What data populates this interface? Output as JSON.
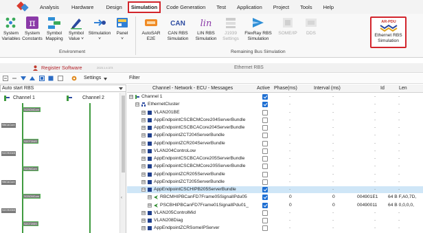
{
  "menu": {
    "items": [
      "Analysis",
      "Hardware",
      "Design",
      "Simulation",
      "Code Generation",
      "Test",
      "Application",
      "Project",
      "Tools",
      "Help"
    ],
    "active": "Simulation"
  },
  "ribbon": {
    "buttons": [
      {
        "l1": "System",
        "l2": "Variables"
      },
      {
        "l1": "System",
        "l2": "Constants"
      },
      {
        "l1": "Symbol",
        "l2": "Mapping"
      },
      {
        "l1": "Symbol",
        "l2": "Value ˅"
      },
      {
        "l1": "Stimulation",
        "l2": "˅"
      },
      {
        "l1": "Panel",
        "l2": "˅"
      },
      {
        "l1": "AutoSAR",
        "l2": "E2E"
      },
      {
        "l1": "CAN RBS",
        "l2": "Simulation"
      },
      {
        "l1": "LIN RBS",
        "l2": "Simulation"
      },
      {
        "l1": "J1939",
        "l2": "Settings"
      },
      {
        "l1": "FlexRay RBS",
        "l2": "Simulation"
      },
      {
        "l1": "SOME/IP",
        "l2": ""
      },
      {
        "l1": "DDS",
        "l2": ""
      },
      {
        "l1": "Ethernet RBS",
        "l2": "Simulation"
      }
    ],
    "icon_texts": {
      "can": "CAN",
      "lin": "lin",
      "ar_pdu": "AR-PDU"
    },
    "groups": {
      "environment": "Environment",
      "remaining": "Remaining Bus Simulation"
    }
  },
  "title": {
    "register": "Register Software",
    "register_sub": "2023.1.4.373",
    "ethernet_rbs": "Ethernet RBS"
  },
  "toolbar": {
    "settings": "Settings",
    "filter": "Filter"
  },
  "left": {
    "autostart": "Auto start RBS",
    "channel1": "Channel 1",
    "channel2": "Channel 2",
    "ecus": [
      "SCBCMCore",
      "SBCACore",
      "SZCT204S",
      "SZCR204S",
      "SZONCore",
      "SBCACore",
      "SCBCMCore",
      "SZCR205S",
      "SZCT205S"
    ]
  },
  "table": {
    "headers": {
      "name": "Channel - Network - ECU - Messages",
      "active": "Active",
      "phase": "Phase(ms)",
      "interval": "Interval (ms)",
      "id": "Id",
      "len": "Len"
    },
    "rows": [
      {
        "name": "Channel 1",
        "indent": 0,
        "exp": "⊟",
        "icon": "channel",
        "active": true,
        "phase": "-",
        "interval": "-",
        "id": "-",
        "len": "-",
        "selected": false
      },
      {
        "name": "EthernetCluster",
        "indent": 1,
        "exp": "⊟",
        "icon": "cluster",
        "active": true,
        "phase": "-",
        "interval": "-",
        "id": "-",
        "len": "-",
        "selected": false
      },
      {
        "name": "VLAN201BE",
        "indent": 2,
        "exp": "⊞",
        "icon": "node",
        "active": false,
        "phase": "-",
        "interval": "-",
        "id": "-",
        "len": "-",
        "selected": false
      },
      {
        "name": "AppEndpointCSCBCMCore204ServerBundle",
        "indent": 2,
        "exp": "⊞",
        "icon": "node",
        "active": false,
        "phase": "-",
        "interval": "-",
        "id": "-",
        "len": "-",
        "selected": false
      },
      {
        "name": "AppEndpointCSCBCACore204ServerBundle",
        "indent": 2,
        "exp": "⊞",
        "icon": "node",
        "active": false,
        "phase": "-",
        "interval": "-",
        "id": "-",
        "len": "-",
        "selected": false
      },
      {
        "name": "AppEndpointZCT204ServerBundle",
        "indent": 2,
        "exp": "⊞",
        "icon": "node",
        "active": false,
        "phase": "-",
        "interval": "-",
        "id": "-",
        "len": "-",
        "selected": false
      },
      {
        "name": "AppEndpointZCR204ServerBundle",
        "indent": 2,
        "exp": "⊞",
        "icon": "node",
        "active": false,
        "phase": "-",
        "interval": "-",
        "id": "-",
        "len": "-",
        "selected": false
      },
      {
        "name": "VLAN204ControLow",
        "indent": 2,
        "exp": "⊞",
        "icon": "node",
        "active": false,
        "phase": "-",
        "interval": "-",
        "id": "-",
        "len": "-",
        "selected": false
      },
      {
        "name": "AppEndpointCSCBCACore205ServerBundle",
        "indent": 2,
        "exp": "⊞",
        "icon": "node",
        "active": false,
        "phase": "-",
        "interval": "-",
        "id": "-",
        "len": "-",
        "selected": false
      },
      {
        "name": "AppEndpointCSCBCMCore205ServerBundle",
        "indent": 2,
        "exp": "⊞",
        "icon": "node",
        "active": false,
        "phase": "-",
        "interval": "-",
        "id": "-",
        "len": "-",
        "selected": false
      },
      {
        "name": "AppEndpointZCR205ServerBundle",
        "indent": 2,
        "exp": "⊞",
        "icon": "node",
        "active": false,
        "phase": "-",
        "interval": "-",
        "id": "-",
        "len": "-",
        "selected": false
      },
      {
        "name": "AppEndpointZCT205ServerBundle",
        "indent": 2,
        "exp": "⊞",
        "icon": "node",
        "active": false,
        "phase": "-",
        "interval": "-",
        "id": "-",
        "len": "-",
        "selected": false
      },
      {
        "name": "AppEndpointCSCHIPB205ServerBundle",
        "indent": 2,
        "exp": "⊟",
        "icon": "node",
        "active": true,
        "phase": "-",
        "interval": "-",
        "id": "-",
        "len": "-",
        "selected": true
      },
      {
        "name": "RBCMHIPBCanFD7Frame05SignalIPdu05",
        "indent": 3,
        "exp": "⊞",
        "icon": "msg",
        "active": true,
        "phase": "0",
        "interval": "0",
        "id": "004901E1",
        "len": "64 B  F,A0,7D,",
        "selected": false
      },
      {
        "name": "PSCBHIPBCanFD7Frame01SignalIPdu01_",
        "indent": 3,
        "exp": "⊞",
        "icon": "msg",
        "active": true,
        "phase": "0",
        "interval": "0",
        "id": "00490011",
        "len": "64 B  0,0,0,0,",
        "selected": false
      },
      {
        "name": "VLAN205ControlMid",
        "indent": 2,
        "exp": "⊞",
        "icon": "node",
        "active": false,
        "phase": "-",
        "interval": "-",
        "id": "-",
        "len": "-",
        "selected": false
      },
      {
        "name": "VLAN208Diag",
        "indent": 2,
        "exp": "⊞",
        "icon": "node",
        "active": false,
        "phase": "-",
        "interval": "-",
        "id": "-",
        "len": "-",
        "selected": false
      },
      {
        "name": "AppEndpointZCRSomeIPServer",
        "indent": 2,
        "exp": "⊞",
        "icon": "node",
        "active": false,
        "phase": "-",
        "interval": "-",
        "id": "-",
        "len": "-",
        "selected": false
      }
    ]
  },
  "colors": {
    "accent_red": "#d2232a",
    "check_blue": "#1e6fd3",
    "selected_row": "#cfe6f7",
    "channel_green": "#3e9a3e"
  }
}
